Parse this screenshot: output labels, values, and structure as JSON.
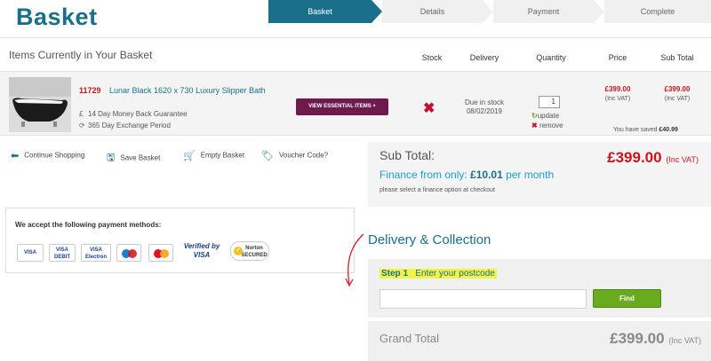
{
  "page": {
    "title": "Basket"
  },
  "steps": [
    {
      "label": "Basket",
      "active": true
    },
    {
      "label": "Details",
      "active": false
    },
    {
      "label": "Payment",
      "active": false
    },
    {
      "label": "Complete",
      "active": false
    }
  ],
  "table": {
    "heading": "Items Currently in Your Basket",
    "columns": {
      "stock": "Stock",
      "delivery": "Delivery",
      "quantity": "Quantity",
      "price": "Price",
      "subtotal": "Sub Total"
    }
  },
  "item": {
    "code": "11729",
    "name": "Lunar Black 1620 x 730 Luxury Slipper Bath",
    "features": [
      "14 Day Money Back Guarantee",
      "365 Day Exchange Period"
    ],
    "essential_button": "VIEW ESSENTIAL ITEMS +",
    "delivery_line1": "Due in stock",
    "delivery_line2": "08/02/2019",
    "quantity": "1",
    "update_label": "update",
    "remove_label": "remove",
    "price": "£399.00",
    "price_vat": "(Inc VAT)",
    "subtotal": "£399.00",
    "subtotal_vat": "(Inc VAT)",
    "saved_label": "You have saved",
    "saved_amount": "£40.99"
  },
  "actions": {
    "continue": "Continue Shopping",
    "save": "Save Basket",
    "empty": "Empty Basket",
    "voucher": "Voucher Code?"
  },
  "summary": {
    "subtotal_label": "Sub Total:",
    "subtotal_amount": "£399.00",
    "inc_vat": "(Inc VAT)",
    "finance_prefix": "Finance from only: ",
    "finance_amount": "£10.01",
    "finance_suffix": " per month",
    "finance_note": "please select a finance option at checkout"
  },
  "payment": {
    "title": "We accept the following payment methods:",
    "cards": [
      "VISA",
      "VISA DEBIT",
      "VISA Electron",
      "Maestro",
      "MasterCard",
      "Verified by VISA",
      "Norton SECURED"
    ]
  },
  "delivery": {
    "title": "Delivery & Collection",
    "step_number": "Step 1",
    "step_text": "Enter your postcode",
    "find_button": "Find"
  },
  "grand": {
    "label": "Grand Total",
    "amount": "£399.00",
    "inc_vat": "(Inc VAT)"
  },
  "colors": {
    "brand": "#1a6f8a",
    "price_red": "#d0121b",
    "button_green": "#6aaa1e",
    "essential_purple": "#6e1a4d"
  }
}
